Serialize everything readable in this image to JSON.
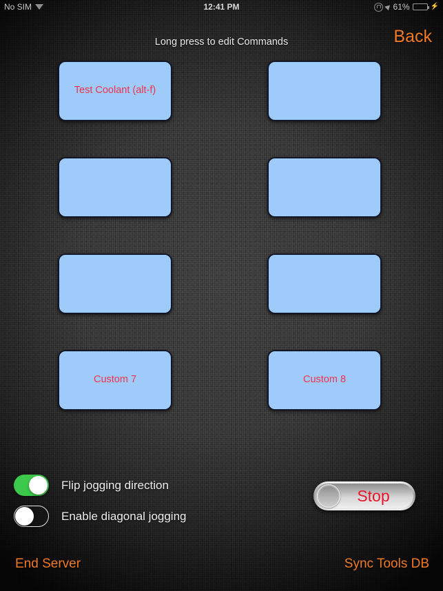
{
  "status_bar": {
    "carrier": "No SIM",
    "wifi_icon": "wifi-icon",
    "time": "12:41 PM",
    "orientation_lock_icon": "rotation-lock-icon",
    "location_icon": "location-arrow-icon",
    "battery_percent": "61%",
    "battery_level": 61,
    "battery_color": "#2fd355",
    "charging_icon": "lightning-bolt-icon"
  },
  "header": {
    "hint": "Long press to edit Commands",
    "back_label": "Back",
    "accent_color": "#f07a22"
  },
  "commands": {
    "button_text_color": "#f0314a",
    "button_fill_color": "#9fcbfb",
    "rows": [
      {
        "left": {
          "label": "Test Coolant (alt-f)"
        },
        "right": {
          "label": ""
        }
      },
      {
        "left": {
          "label": ""
        },
        "right": {
          "label": ""
        }
      },
      {
        "left": {
          "label": ""
        },
        "right": {
          "label": ""
        }
      },
      {
        "left": {
          "label": "Custom 7"
        },
        "right": {
          "label": "Custom 8"
        }
      }
    ]
  },
  "toggles": [
    {
      "label": "Flip jogging direction",
      "state": "on",
      "on_color": "#3cc94b"
    },
    {
      "label": "Enable diagonal jogging",
      "state": "off",
      "on_color": "#3cc94b"
    }
  ],
  "stop_control": {
    "label": "Stop",
    "label_color": "#e8122a"
  },
  "footer": {
    "end_server_label": "End Server",
    "sync_tools_label": "Sync Tools DB",
    "accent_color": "#f07a22"
  }
}
